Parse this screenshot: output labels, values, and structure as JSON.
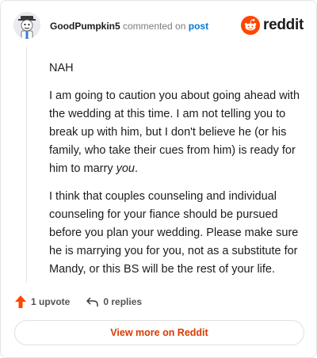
{
  "comment": {
    "username": "GoodPumpkin5",
    "action_text": "commented on",
    "post_link": "post",
    "paragraphs": [
      {
        "text": "NAH"
      },
      {
        "text_before": "I am going to caution you about going ahead with the wedding at this time. I am not telling you to break up with him, but I don't believe he (or his family, who take their cues from him) is ready for him to marry ",
        "emphasis": "you",
        "text_after": "."
      },
      {
        "text": "I think that couples counseling and individual counseling for your fiance should be pursued before you plan your wedding. Please make sure he is marrying you for you, not as a substitute for Mandy, or this BS will be the rest of your life."
      }
    ]
  },
  "brand": {
    "wordmark": "reddit",
    "logo_icon": "reddit-snoo-icon",
    "accent": "#ff4500"
  },
  "footer": {
    "upvote_label": "1 upvote",
    "upvote_icon": "upvote-arrow-icon",
    "upvote_color": "#ff4500",
    "replies_label": "0 replies",
    "reply_icon": "reply-arrow-icon"
  },
  "cta": {
    "label": "View more on Reddit",
    "color": "#d93a00"
  }
}
